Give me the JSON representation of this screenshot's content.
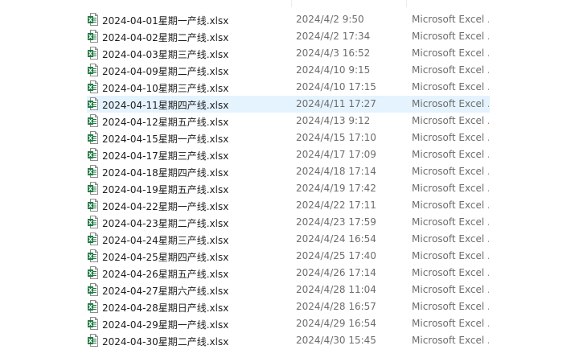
{
  "file_list": {
    "selected_index": 5,
    "icon": "excel-file-icon",
    "colors": {
      "selection": "#e5f3ff",
      "excel_green": "#1f7a43"
    },
    "rows": [
      {
        "name": "2024-04-01星期一产线.xlsx",
        "modified": "2024/4/2 9:50",
        "type": "Microsoft Excel ..."
      },
      {
        "name": "2024-04-02星期二产线.xlsx",
        "modified": "2024/4/2 17:34",
        "type": "Microsoft Excel ..."
      },
      {
        "name": "2024-04-03星期三产线.xlsx",
        "modified": "2024/4/3 16:52",
        "type": "Microsoft Excel ..."
      },
      {
        "name": "2024-04-09星期二产线.xlsx",
        "modified": "2024/4/10 9:15",
        "type": "Microsoft Excel ..."
      },
      {
        "name": "2024-04-10星期三产线.xlsx",
        "modified": "2024/4/10 17:15",
        "type": "Microsoft Excel ..."
      },
      {
        "name": "2024-04-11星期四产线.xlsx",
        "modified": "2024/4/11 17:27",
        "type": "Microsoft Excel ..."
      },
      {
        "name": "2024-04-12星期五产线.xlsx",
        "modified": "2024/4/13 9:12",
        "type": "Microsoft Excel ..."
      },
      {
        "name": "2024-04-15星期一产线.xlsx",
        "modified": "2024/4/15 17:10",
        "type": "Microsoft Excel ..."
      },
      {
        "name": "2024-04-17星期三产线.xlsx",
        "modified": "2024/4/17 17:09",
        "type": "Microsoft Excel ..."
      },
      {
        "name": "2024-04-18星期四产线.xlsx",
        "modified": "2024/4/18 17:14",
        "type": "Microsoft Excel ..."
      },
      {
        "name": "2024-04-19星期五产线.xlsx",
        "modified": "2024/4/19 17:42",
        "type": "Microsoft Excel ..."
      },
      {
        "name": "2024-04-22星期一产线.xlsx",
        "modified": "2024/4/22 17:11",
        "type": "Microsoft Excel ..."
      },
      {
        "name": "2024-04-23星期二产线.xlsx",
        "modified": "2024/4/23 17:59",
        "type": "Microsoft Excel ..."
      },
      {
        "name": "2024-04-24星期三产线.xlsx",
        "modified": "2024/4/24 16:54",
        "type": "Microsoft Excel ..."
      },
      {
        "name": "2024-04-25星期四产线.xlsx",
        "modified": "2024/4/25 17:40",
        "type": "Microsoft Excel ..."
      },
      {
        "name": "2024-04-26星期五产线.xlsx",
        "modified": "2024/4/26 17:14",
        "type": "Microsoft Excel ..."
      },
      {
        "name": "2024-04-27星期六产线.xlsx",
        "modified": "2024/4/28 11:04",
        "type": "Microsoft Excel ..."
      },
      {
        "name": "2024-04-28星期日产线.xlsx",
        "modified": "2024/4/28 16:57",
        "type": "Microsoft Excel ..."
      },
      {
        "name": "2024-04-29星期一产线.xlsx",
        "modified": "2024/4/29 16:54",
        "type": "Microsoft Excel ..."
      },
      {
        "name": "2024-04-30星期二产线.xlsx",
        "modified": "2024/4/30 15:45",
        "type": "Microsoft Excel ..."
      }
    ]
  }
}
